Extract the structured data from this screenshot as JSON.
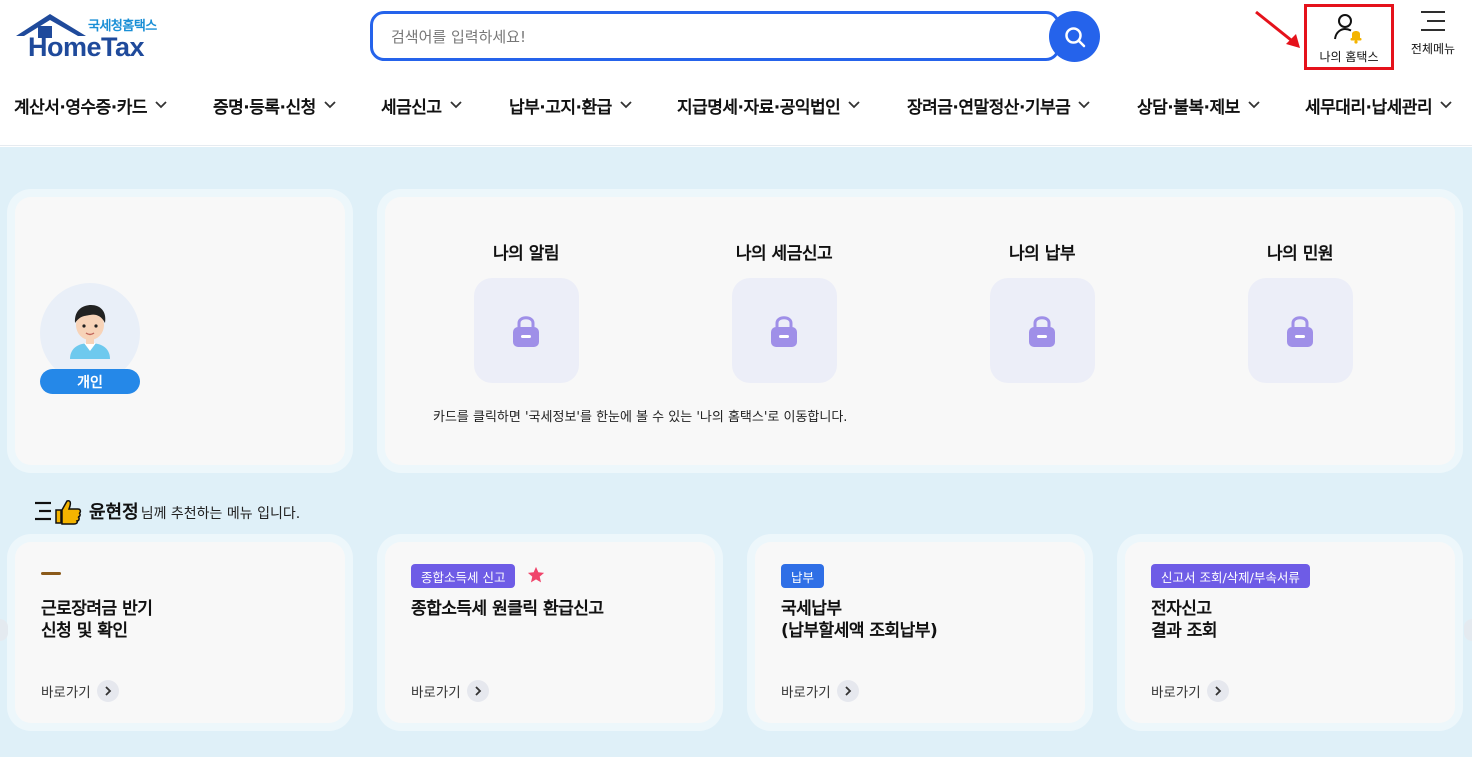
{
  "header": {
    "logo_sub": "국세청홈택스",
    "logo_main": "HomeTax",
    "search_placeholder": "검색어를 입력하세요!",
    "my_hometax_label": "나의 홈택스",
    "all_menu_label": "전체메뉴"
  },
  "gnb": [
    {
      "label": "계산서·영수증·카드"
    },
    {
      "label": "증명·등록·신청"
    },
    {
      "label": "세금신고"
    },
    {
      "label": "납부·고지·환급"
    },
    {
      "label": "지급명세·자료·공익법인"
    },
    {
      "label": "장려금·연말정산·기부금"
    },
    {
      "label": "상담·불복·제보"
    },
    {
      "label": "세무대리·납세관리"
    }
  ],
  "profile": {
    "type_label": "개인"
  },
  "my_items": [
    {
      "label": "나의 알림"
    },
    {
      "label": "나의 세금신고"
    },
    {
      "label": "나의 납부"
    },
    {
      "label": "나의 민원"
    }
  ],
  "my_note": "카드를 클릭하면 '국세정보'를 한눈에 볼 수 있는 '나의 홈택스'로 이동합니다.",
  "recommend": {
    "user_name": "윤현정",
    "suffix": "님께 추천하는 메뉴 입니다.",
    "cards": [
      {
        "tag": "",
        "title": "근로장려금 반기\n신청 및 확인",
        "link": "바로가기"
      },
      {
        "tag": "종합소득세 신고",
        "tag_color": "#6e5ce6",
        "title": "종합소득세 원클릭 환급신고",
        "link": "바로가기"
      },
      {
        "tag": "납부",
        "tag_color": "#2f6fe6",
        "title": "국세납부\n(납부할세액 조회납부)",
        "link": "바로가기"
      },
      {
        "tag": "신고서 조회/삭제/부속서류",
        "tag_color": "#6e5ce6",
        "title": "전자신고\n결과 조회",
        "link": "바로가기"
      }
    ]
  },
  "colors": {
    "accent": "#2563eb",
    "highlight": "#e5121b",
    "background": "#dff0f8"
  }
}
